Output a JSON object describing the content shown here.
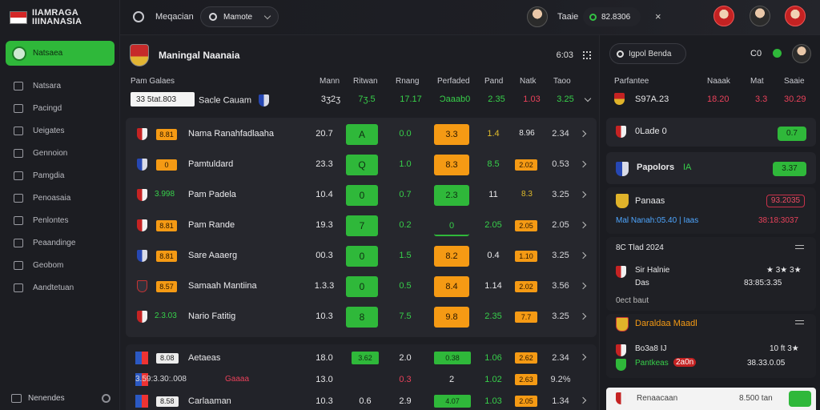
{
  "brand": {
    "line1": "IIAMRAGA",
    "line2": "IIINANASIA"
  },
  "sidebar": {
    "active_label": "Natsaea",
    "items": [
      {
        "label": "Natsara",
        "icon": "home-icon"
      },
      {
        "label": "Pacingd",
        "icon": "search-icon"
      },
      {
        "label": "Ueigates",
        "icon": "square-icon"
      },
      {
        "label": "Gennoion",
        "icon": "chat-icon"
      },
      {
        "label": "Pamgdia",
        "icon": "chat-icon"
      },
      {
        "label": "Penoasaia",
        "icon": "chart-icon"
      },
      {
        "label": "Penlontes",
        "icon": "folder-icon"
      },
      {
        "label": "Peaandinge",
        "icon": "list-icon"
      },
      {
        "label": "Geobom",
        "icon": "image-icon"
      },
      {
        "label": "Aandtetuan",
        "icon": "doc-icon"
      }
    ],
    "footer_label": "Nenendes"
  },
  "topbar": {
    "nav_label": "Meqacian",
    "search_value": "Mamote",
    "user_label": "Taaie",
    "balance": "82.8306",
    "close_glyph": "×"
  },
  "match": {
    "title": "Maningal Naanaia",
    "time": "6:03",
    "columns": [
      "Pam Galaes",
      "Mann",
      "Ritwan",
      "Rnang",
      "Perfaded",
      "Pand",
      "Natk",
      "Taoo"
    ],
    "reference": {
      "pill": "33 5tat.803",
      "label": "Sacle Cauam",
      "num": "3ʒ2ʒ",
      "a": "7ʒ.5",
      "b": "17.17",
      "c": "Ɔaaab0",
      "d": "2.35",
      "e": "1.03",
      "f": "3.25"
    }
  },
  "rows": [
    {
      "badge": "8.81",
      "team": "Nama Ranahfadlaaha",
      "crest": "red",
      "num": "20.7",
      "green": "A",
      "v1": "0.0",
      "box": "3.3",
      "box_style": "or",
      "a": "1.4",
      "a_color": "yellow",
      "b": "8.96",
      "b_style": "text",
      "c": "2.34"
    },
    {
      "badge": "0",
      "team": "Pamtuldard",
      "crest": "blue",
      "num": "23.3",
      "green": "Q",
      "v1": "1.0",
      "box": "8.3",
      "box_style": "or",
      "a": "8.5",
      "a_color": "green",
      "b": "2.02",
      "b_style": "tag",
      "c": "0.53"
    },
    {
      "badge": "3.998",
      "badge_style": "text",
      "team": "Pam Padela",
      "crest": "red",
      "num": "10.4",
      "green": "0",
      "v1": "0.7",
      "box": "2.3",
      "box_style": "g",
      "a": "11",
      "a_color": "white",
      "b": "8.3",
      "b_style": "text-y",
      "c": "3.25"
    },
    {
      "badge": "8.81",
      "team": "Pam Rande",
      "crest": "usa",
      "num": "19.3",
      "green": "7",
      "v1": "0.2",
      "box": "0",
      "box_style": "line",
      "a": "2.05",
      "a_color": "green",
      "b": "2.05",
      "b_style": "tag",
      "c": "2.05"
    },
    {
      "badge": "8.81",
      "team": "Sare Aaaerg",
      "crest": "blue",
      "num": "00.3",
      "green": "0",
      "v1": "1.5",
      "box": "8.2",
      "box_style": "or",
      "a": "0.4",
      "a_color": "white",
      "b": "1.10",
      "b_style": "tag",
      "c": "3.25"
    },
    {
      "badge": "8.57",
      "team": "Samaah Mantiina",
      "crest": "dark",
      "num": "1.3.3",
      "green": "0",
      "v1": "0.5",
      "box": "8.4",
      "box_style": "or",
      "a": "1.14",
      "a_color": "white",
      "b": "2.02",
      "b_style": "tag",
      "c": "3.56"
    },
    {
      "badge": "2.3.03",
      "badge_style": "text",
      "team": "Nario Fatitig",
      "crest": "red",
      "num": "10.3",
      "green": "8",
      "v1": "7.5",
      "box": "9.8",
      "box_style": "or",
      "a": "2.35",
      "a_color": "green",
      "b": "7.7",
      "b_style": "tag",
      "c": "3.25"
    }
  ],
  "lower": [
    {
      "badge": "8.08",
      "team": "Aetaeas",
      "num": "18.0",
      "g1": "3.62",
      "v": "2.0",
      "g2": "0.38",
      "a": "1.06",
      "b": "2.62",
      "c": "2.34"
    },
    {
      "badge": "3.59:3.30:.008",
      "team": "Gaaaa",
      "num": "13.0",
      "v": "0.3",
      "v2": "2",
      "a": "1.02",
      "b": "2.63",
      "c": "9.2%"
    },
    {
      "badge": "8.58",
      "team": "Carlaaman",
      "num": "10.3",
      "v": "2.9",
      "v0": "0.6",
      "g2": "4.07",
      "a": "1.03",
      "b": "2.05",
      "c": "1.34"
    }
  ],
  "right": {
    "search": "Igpol Benda",
    "stat": "C0",
    "columns": [
      "Parfantee",
      "Naaak",
      "Mat",
      "Saaie"
    ],
    "top_row": {
      "label": "S97A.23",
      "a": "18.20",
      "b": "3.3",
      "c": "30.29"
    },
    "cards": [
      {
        "title": "0Lade 0",
        "pill": "0.7"
      },
      {
        "title": "Papolors",
        "sub": "IA",
        "pill": "3.37"
      },
      {
        "title": "Panaas",
        "pill": "93.2035",
        "line": "Mal Nanah:05.40 | Iaas",
        "line_r": "38:18:3037"
      },
      {
        "title": "8C Tlad 2024",
        "team": "Sir Halnie",
        "team2": "Das",
        "stars": "★ 3★ 3★",
        "vals": "83:85:3.35",
        "sub": "0ect baut"
      },
      {
        "title": "Daraldaa Maadl",
        "team": "Bo3a8 IJ",
        "team_r": "10 ft 3★",
        "team2": "Pantkeas",
        "team2_tag": "2a0n",
        "vals": "38.33.0.05"
      }
    ],
    "bottom": {
      "label": "Renaacaan",
      "value": "8.500 tan"
    }
  }
}
